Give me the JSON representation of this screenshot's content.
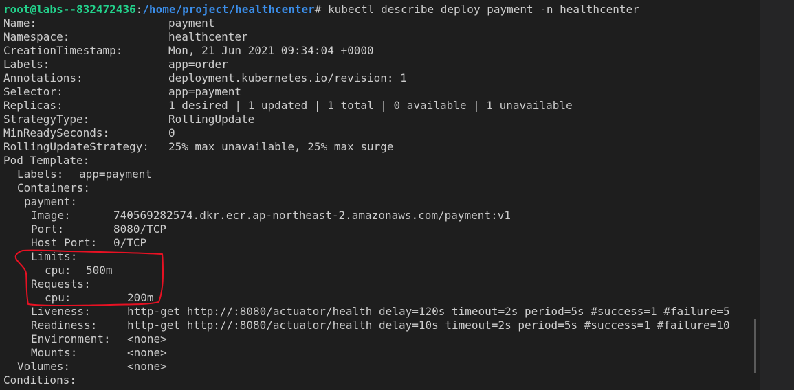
{
  "terminal": {
    "prompt_user": "root@labs--832472436",
    "prompt_sep": ":",
    "prompt_path": "/home/project/healthcenter",
    "prompt_symbol": "# ",
    "command": "kubectl describe deploy payment -n healthcenter",
    "output": [
      {
        "key": "Name:",
        "value": "payment"
      },
      {
        "key": "Namespace:",
        "value": "healthcenter"
      },
      {
        "key": "CreationTimestamp:",
        "value": "Mon, 21 Jun 2021 09:34:04 +0000"
      },
      {
        "key": "Labels:",
        "value": "app=order"
      },
      {
        "key": "Annotations:",
        "value": "deployment.kubernetes.io/revision: 1"
      },
      {
        "key": "Selector:",
        "value": "app=payment"
      },
      {
        "key": "Replicas:",
        "value": "1 desired | 1 updated | 1 total | 0 available | 1 unavailable"
      },
      {
        "key": "StrategyType:",
        "value": "RollingUpdate"
      },
      {
        "key": "MinReadySeconds:",
        "value": "0"
      },
      {
        "key": "RollingUpdateStrategy:",
        "value": "25% max unavailable, 25% max surge"
      },
      {
        "key": "Pod Template:",
        "value": ""
      },
      {
        "key": "Labels:",
        "value": "app=payment"
      },
      {
        "key": "Containers:",
        "value": ""
      },
      {
        "key": "payment:",
        "value": ""
      },
      {
        "key": "Image:",
        "value": "740569282574.dkr.ecr.ap-northeast-2.amazonaws.com/payment:v1"
      },
      {
        "key": "Port:",
        "value": "8080/TCP"
      },
      {
        "key": "Host Port:",
        "value": "0/TCP"
      },
      {
        "key": "Limits:",
        "value": ""
      },
      {
        "key": "cpu:",
        "value": "500m"
      },
      {
        "key": "Requests:",
        "value": ""
      },
      {
        "key": "cpu:",
        "value": "200m"
      },
      {
        "key": "Liveness:",
        "value": "http-get http://:8080/actuator/health delay=120s timeout=2s period=5s #success=1 #failure=5"
      },
      {
        "key": "Readiness:",
        "value": "http-get http://:8080/actuator/health delay=10s timeout=2s period=5s #success=1 #failure=10"
      },
      {
        "key": "Environment:",
        "value": "<none>"
      },
      {
        "key": "Mounts:",
        "value": "<none>"
      },
      {
        "key": "Volumes:",
        "value": "<none>"
      },
      {
        "key": "Conditions:",
        "value": ""
      }
    ]
  },
  "annotation_color": "#e81123"
}
